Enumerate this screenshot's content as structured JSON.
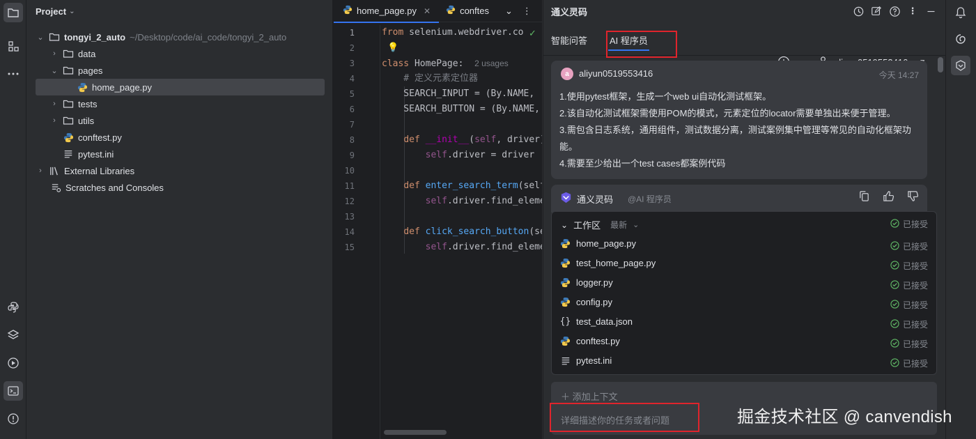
{
  "project": {
    "title": "Project",
    "tree": [
      {
        "label": "tongyi_2_auto",
        "path": "~/Desktop/code/ai_code/tongyi_2_auto"
      },
      {
        "label": "data"
      },
      {
        "label": "pages"
      },
      {
        "label": "home_page.py"
      },
      {
        "label": "tests"
      },
      {
        "label": "utils"
      },
      {
        "label": "conftest.py"
      },
      {
        "label": "pytest.ini"
      },
      {
        "label": "External Libraries"
      },
      {
        "label": "Scratches and Consoles"
      }
    ]
  },
  "editor": {
    "tabs": [
      {
        "label": "home_page.py"
      },
      {
        "label": "conftes"
      }
    ],
    "line_numbers": [
      "1",
      "2",
      "3",
      "4",
      "5",
      "6",
      "7",
      "8",
      "9",
      "10",
      "11",
      "12",
      "13",
      "14",
      "15"
    ],
    "usages_hint": "2 usages",
    "code": {
      "l1_kw": "from",
      "l1_rest": " selenium.webdriver.co",
      "l3_kw": "class",
      "l3_name": " HomePage:",
      "l4": "    # 定义元素定位器",
      "l5": "    SEARCH_INPUT = (By.NAME, '",
      "l6": "    SEARCH_BUTTON = (By.NAME,",
      "l8_kw": "def",
      "l8_fn": "__init__",
      "l8_open": "(",
      "l8_self": "self",
      "l8_rest": ", driver)",
      "l9_self": "self",
      "l9_rest": ".driver = driver",
      "l11_kw": "def",
      "l11_fn": "enter_search_term",
      "l11_rest": "(self",
      "l12_self": "self",
      "l12_rest": ".driver.find_eleme",
      "l14_kw": "def",
      "l14_fn": "click_search_button",
      "l14_rest": "(se",
      "l15_self": "self",
      "l15_rest": ".driver.find_eleme"
    }
  },
  "ai": {
    "title": "通义灵码",
    "tabs": [
      {
        "label": "智能问答"
      },
      {
        "label": "AI 程序员"
      }
    ],
    "user": "aliyun0519553416",
    "message": {
      "avatar_letter": "a",
      "user": "aliyun0519553416",
      "time": "今天 14:27",
      "lines": [
        "1.使用pytest框架，生成一个web ui自动化测试框架。",
        "2.该自动化测试框架需使用POM的模式，元素定位的locator需要单独出来便于管理。",
        "3.需包含日志系统，通用组件，测试数据分离，测试案例集中管理等常见的自动化框架功",
        "能。",
        "4.需要至少给出一个test cases都案例代码"
      ]
    },
    "reply": {
      "name": "通义灵码",
      "role": "@AI 程序员"
    },
    "workspace": {
      "title": "工作区",
      "filter": "最新",
      "status": "已接受",
      "files": [
        {
          "name": "home_page.py",
          "type": "python",
          "status": "已接受"
        },
        {
          "name": "test_home_page.py",
          "type": "python",
          "status": "已接受"
        },
        {
          "name": "logger.py",
          "type": "python",
          "status": "已接受"
        },
        {
          "name": "config.py",
          "type": "python",
          "status": "已接受"
        },
        {
          "name": "test_data.json",
          "type": "json",
          "status": "已接受"
        },
        {
          "name": "conftest.py",
          "type": "python",
          "status": "已接受"
        },
        {
          "name": "pytest.ini",
          "type": "ini",
          "status": "已接受"
        }
      ]
    },
    "context": {
      "add_label": "添加上下文",
      "placeholder": "详细描述你的任务或者问题"
    }
  },
  "watermark": "掘金技术社区 @ canvendish",
  "colors": {
    "accent": "#3574f0",
    "highlight_box": "#e0242c",
    "accepted": "#5fb865"
  }
}
